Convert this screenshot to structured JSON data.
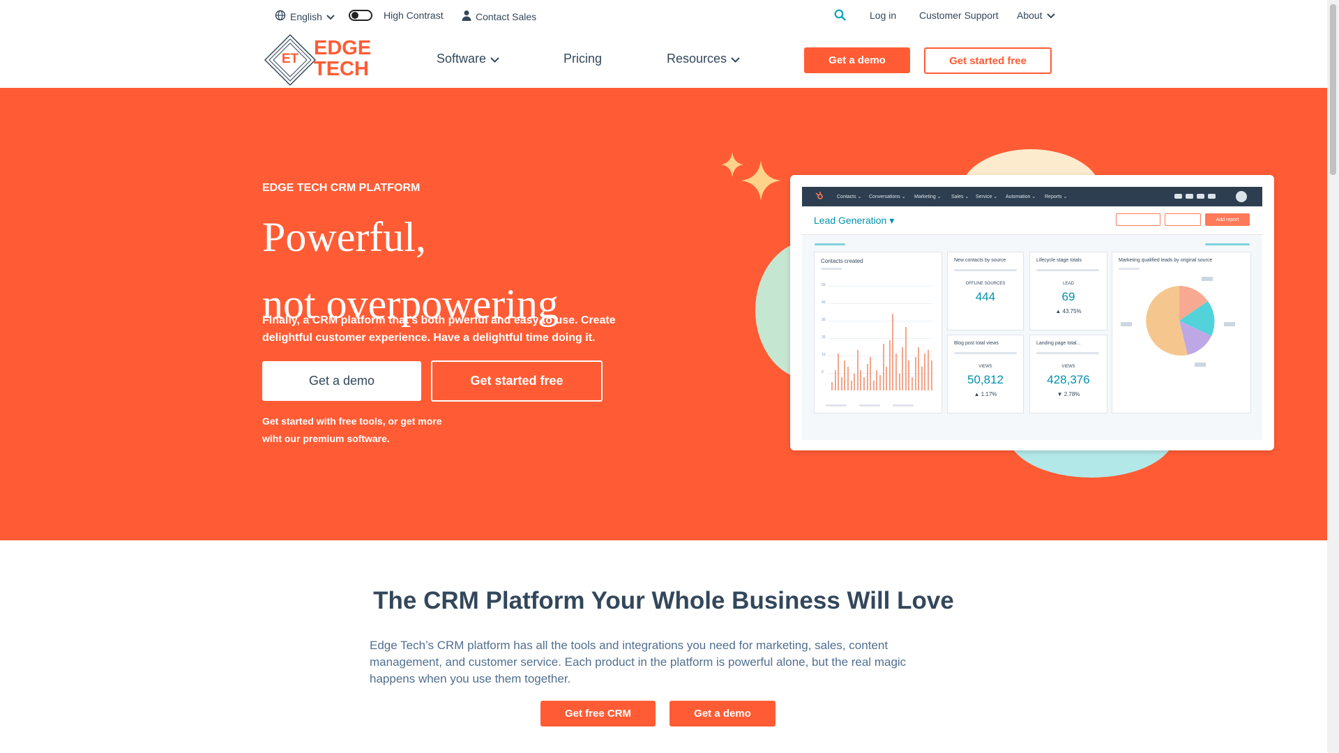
{
  "utility": {
    "language": "English",
    "high_contrast": "High Contrast",
    "contact_sales": "Contact Sales",
    "login": "Log in",
    "support": "Customer Support",
    "about": "About"
  },
  "brand": {
    "mark": "ET",
    "line1": "EDGE",
    "line2": "TECH",
    "color": "#ff5c35"
  },
  "nav": {
    "software": "Software",
    "pricing": "Pricing",
    "resources": "Resources",
    "demo": "Get a demo",
    "started": "Get started free"
  },
  "hero": {
    "eyebrow": "EDGE TECH CRM PLATFORM",
    "title_line1": "Powerful,",
    "title_line2": "not overpowering",
    "subtitle": "Finally, a CRM platform that's both pwerful and easy to use. Create delightful customer experience. Have a delightful time doing it.",
    "demo_button": "Get a demo",
    "started_button": "Get started free",
    "note": "Get started with free tools, or get more wiht our premium software.",
    "bg_color": "#ff5c35"
  },
  "dashboard": {
    "menu": [
      "Contacts ⌄",
      "Conversations ⌄",
      "Marketing ⌄",
      "Sales ⌄",
      "Service ⌄",
      "Automation ⌄",
      "Reports ⌄"
    ],
    "report_title": "Lead Generation ▾",
    "add_report": "Add report",
    "cards": {
      "contacts_created": "Contacts created",
      "new_contacts": {
        "title": "New contacts by source",
        "caption": "OFFLINE SOURCES",
        "value": "444"
      },
      "lifecycle": {
        "title": "Lifecycle stage totals",
        "caption": "LEAD",
        "value": "69",
        "pct": "▲ 43.75%"
      },
      "mql": {
        "title": "Marketing qualified leads by original source"
      },
      "blog": {
        "title": "Blog post total views",
        "caption": "VIEWS",
        "value": "50,812",
        "pct": "▲ 1.17%"
      },
      "landing": {
        "title": "Landing page total...",
        "caption": "VIEWS",
        "value": "428,376",
        "pct": "▼ 2.78%"
      }
    },
    "contacts_axis": [
      "50",
      "40",
      "30",
      "20",
      "10",
      "0"
    ]
  },
  "section": {
    "title": "The CRM Platform Your Whole Business Will Love",
    "body": "Edge Tech’s CRM platform has all the tools and integrations you need for marketing, sales, content management, and customer service. Each product in the platform is powerful alone, but the real magic happens when you use them together.",
    "crm_button": "Get free CRM",
    "demo_button": "Get a demo"
  }
}
